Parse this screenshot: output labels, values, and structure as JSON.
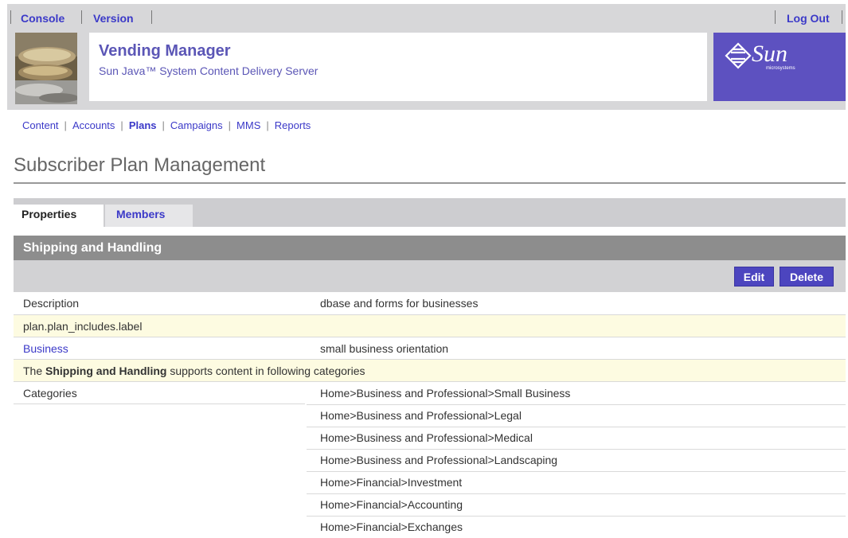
{
  "topbar": {
    "console": "Console",
    "version": "Version",
    "logout": "Log Out"
  },
  "masthead": {
    "title": "Vending Manager",
    "subtitle": "Sun Java™ System Content Delivery Server",
    "logo_word": "Sun",
    "logo_small": "microsystems"
  },
  "nav": {
    "items": [
      "Content",
      "Accounts",
      "Plans",
      "Campaigns",
      "MMS",
      "Reports"
    ],
    "current": "Plans"
  },
  "page_title": "Subscriber Plan Management",
  "tabs": [
    {
      "label": "Properties",
      "active": true
    },
    {
      "label": "Members",
      "active": false
    }
  ],
  "section": {
    "title": "Shipping and Handling",
    "edit": "Edit",
    "delete": "Delete"
  },
  "rows": {
    "description_label": "Description",
    "description_value": "dbase and forms for businesses",
    "includes_label": "plan.plan_includes.label",
    "business_label": "Business",
    "business_value": "small business orientation",
    "supports_prefix": "The",
    "supports_name": "Shipping and Handling",
    "supports_suffix": "supports content in following categories",
    "categories_label": "Categories"
  },
  "categories": [
    "Home>Business and Professional>Small Business",
    "Home>Business and Professional>Legal",
    "Home>Business and Professional>Medical",
    "Home>Business and Professional>Landscaping",
    "Home>Financial>Investment",
    "Home>Financial>Accounting",
    "Home>Financial>Exchanges"
  ],
  "colors": {
    "link": "#3b39c8",
    "brand_purple": "#5d51c0",
    "button": "#4c45bf",
    "header_gray": "#8d8d8d",
    "highlight_row": "#fdfbe1"
  }
}
